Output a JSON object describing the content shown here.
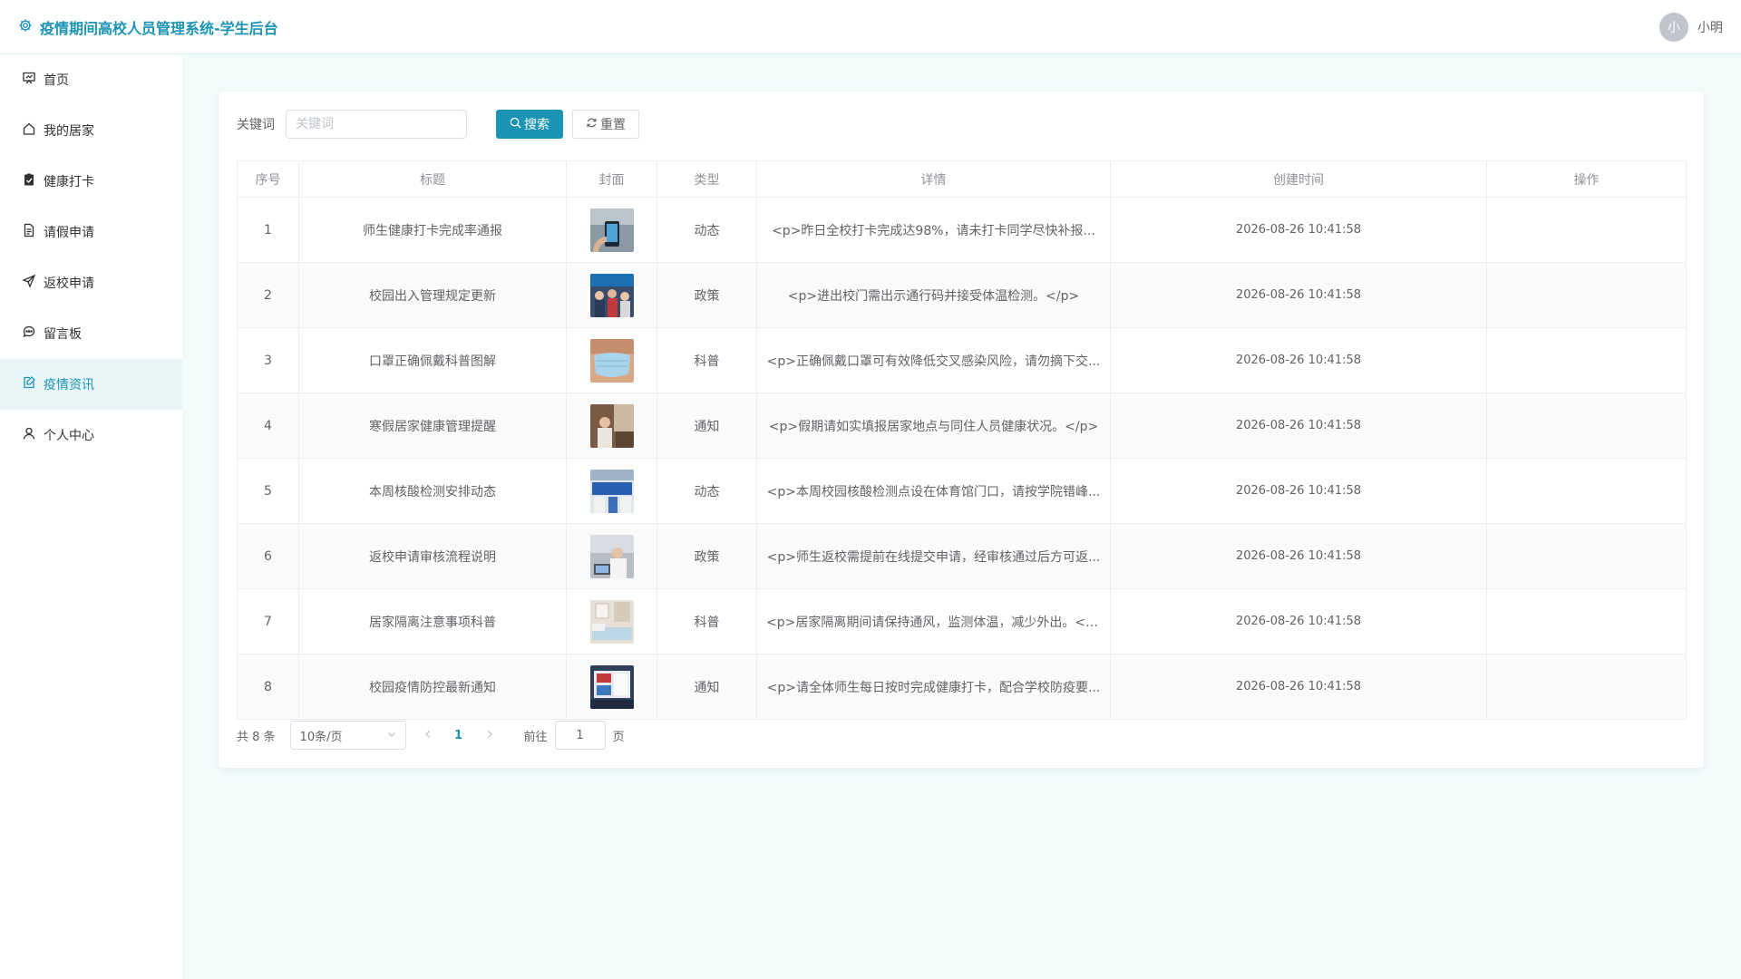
{
  "app": {
    "title": "疫情期间高校人员管理系统-学生后台",
    "accent": "#1a93b5"
  },
  "user": {
    "avatar_initial": "小",
    "name": "小明"
  },
  "sidebar": {
    "items": [
      {
        "label": "首页",
        "icon": "dashboard-icon"
      },
      {
        "label": "我的居家",
        "icon": "home-icon"
      },
      {
        "label": "健康打卡",
        "icon": "clipboard-check-icon"
      },
      {
        "label": "请假申请",
        "icon": "document-icon"
      },
      {
        "label": "返校申请",
        "icon": "send-icon"
      },
      {
        "label": "留言板",
        "icon": "chat-icon"
      },
      {
        "label": "疫情资讯",
        "icon": "news-icon",
        "active": true
      },
      {
        "label": "个人中心",
        "icon": "user-icon"
      }
    ]
  },
  "search": {
    "label": "关键词",
    "placeholder": "关键词",
    "value": "",
    "search_button": "搜索",
    "reset_button": "重置"
  },
  "table": {
    "headers": [
      "序号",
      "标题",
      "封面",
      "类型",
      "详情",
      "创建时间",
      "操作"
    ],
    "rows": [
      {
        "index": "1",
        "title": "师生健康打卡完成率通报",
        "cover": "phone-checkin",
        "type": "动态",
        "detail": "<p>昨日全校打卡完成达98%，请未打卡同学尽快补报...",
        "created": "2026-08-26 10:41:58"
      },
      {
        "index": "2",
        "title": "校园出入管理规定更新",
        "cover": "crowd-gate",
        "type": "政策",
        "detail": "<p>进出校门需出示通行码并接受体温检测。</p>",
        "created": "2026-08-26 10:41:58"
      },
      {
        "index": "3",
        "title": "口罩正确佩戴科普图解",
        "cover": "face-mask",
        "type": "科普",
        "detail": "<p>正确佩戴口罩可有效降低交叉感染风险，请勿摘下交...",
        "created": "2026-08-26 10:41:58"
      },
      {
        "index": "4",
        "title": "寒假居家健康管理提醒",
        "cover": "home-room",
        "type": "通知",
        "detail": "<p>假期请如实填报居家地点与同住人员健康状况。</p>",
        "created": "2026-08-26 10:41:58"
      },
      {
        "index": "5",
        "title": "本周核酸检测安排动态",
        "cover": "testing-site",
        "type": "动态",
        "detail": "<p>本周校园核酸检测点设在体育馆门口，请按学院错峰...",
        "created": "2026-08-26 10:41:58"
      },
      {
        "index": "6",
        "title": "返校申请审核流程说明",
        "cover": "office-desk",
        "type": "政策",
        "detail": "<p>师生返校需提前在线提交申请，经审核通过后方可返...",
        "created": "2026-08-26 10:41:58"
      },
      {
        "index": "7",
        "title": "居家隔离注意事项科普",
        "cover": "bedroom",
        "type": "科普",
        "detail": "<p>居家隔离期间请保持通风，监测体温，减少外出。</p>",
        "created": "2026-08-26 10:41:58"
      },
      {
        "index": "8",
        "title": "校园疫情防控最新通知",
        "cover": "notice-board",
        "type": "通知",
        "detail": "<p>请全体师生每日按时完成健康打卡，配合学校防疫要...",
        "created": "2026-08-26 10:41:58"
      }
    ]
  },
  "pagination": {
    "total_text": "共 8 条",
    "page_size": "10条/页",
    "current_page": "1",
    "goto_label": "前往",
    "goto_value": "1",
    "page_suffix": "页"
  }
}
